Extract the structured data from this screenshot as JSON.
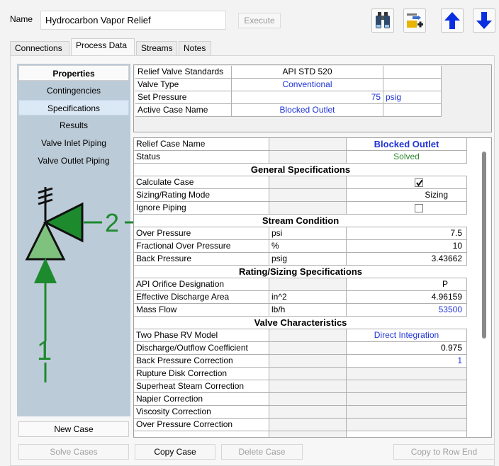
{
  "header": {
    "name_label": "Name",
    "name_value": "Hydrocarbon Vapor Relief",
    "execute_label": "Execute"
  },
  "tabs": [
    {
      "label": "Connections"
    },
    {
      "label": "Process Data"
    },
    {
      "label": "Streams"
    },
    {
      "label": "Notes"
    }
  ],
  "sidebar": {
    "items": [
      {
        "label": "Properties"
      },
      {
        "label": "Contingencies"
      },
      {
        "label": "Specifications"
      },
      {
        "label": "Results"
      },
      {
        "label": "Valve Inlet Piping"
      },
      {
        "label": "Valve Outlet Piping"
      }
    ],
    "diagram": {
      "label_inlet": "1",
      "label_outlet": "2"
    }
  },
  "standards": {
    "rows": [
      {
        "label": "Relief Valve Standards",
        "value": "API STD 520",
        "unit": ""
      },
      {
        "label": "Valve Type",
        "value": "Conventional",
        "unit": ""
      },
      {
        "label": "Set Pressure",
        "value": "75",
        "unit": "psig"
      },
      {
        "label": "Active Case Name",
        "value": "Blocked Outlet",
        "unit": ""
      }
    ]
  },
  "case": {
    "name_label": "Relief Case Name",
    "name_value": "Blocked Outlet",
    "status_label": "Status",
    "status_value": "Solved",
    "sections": {
      "general": "General Specifications",
      "stream": "Stream Condition",
      "rating": "Rating/Sizing Specifications",
      "valve": "Valve Characteristics"
    },
    "rows": [
      {
        "label": "Calculate Case",
        "unit": "",
        "value": ""
      },
      {
        "label": "Sizing/Rating Mode",
        "unit": "",
        "value": "Sizing"
      },
      {
        "label": "Ignore Piping",
        "unit": "",
        "value": ""
      },
      {
        "label": "Over Pressure",
        "unit": "psi",
        "value": "7.5"
      },
      {
        "label": "Fractional Over Pressure",
        "unit": "%",
        "value": "10"
      },
      {
        "label": "Back Pressure",
        "unit": "psig",
        "value": "3.43662"
      },
      {
        "label": "API Orifice Designation",
        "unit": "",
        "value": "P"
      },
      {
        "label": "Effective Discharge Area",
        "unit": "in^2",
        "value": "4.96159"
      },
      {
        "label": "Mass Flow",
        "unit": "lb/h",
        "value": "53500"
      },
      {
        "label": "Two Phase RV Model",
        "unit": "",
        "value": "Direct Integration"
      },
      {
        "label": "Discharge/Outflow Coefficient",
        "unit": "",
        "value": "0.975"
      },
      {
        "label": "Back Pressure Correction",
        "unit": "",
        "value": "1"
      },
      {
        "label": "Rupture Disk Correction",
        "unit": "",
        "value": ""
      },
      {
        "label": "Superheat Steam Correction",
        "unit": "",
        "value": ""
      },
      {
        "label": "Napier Correction",
        "unit": "",
        "value": ""
      },
      {
        "label": "Viscosity Correction",
        "unit": "",
        "value": ""
      },
      {
        "label": "Over Pressure Correction",
        "unit": "",
        "value": ""
      }
    ]
  },
  "buttons": {
    "new_case": "New Case",
    "solve_cases": "Solve Cases",
    "copy_case": "Copy Case",
    "delete_case": "Delete Case",
    "copy_to_row_end": "Copy to Row End"
  }
}
